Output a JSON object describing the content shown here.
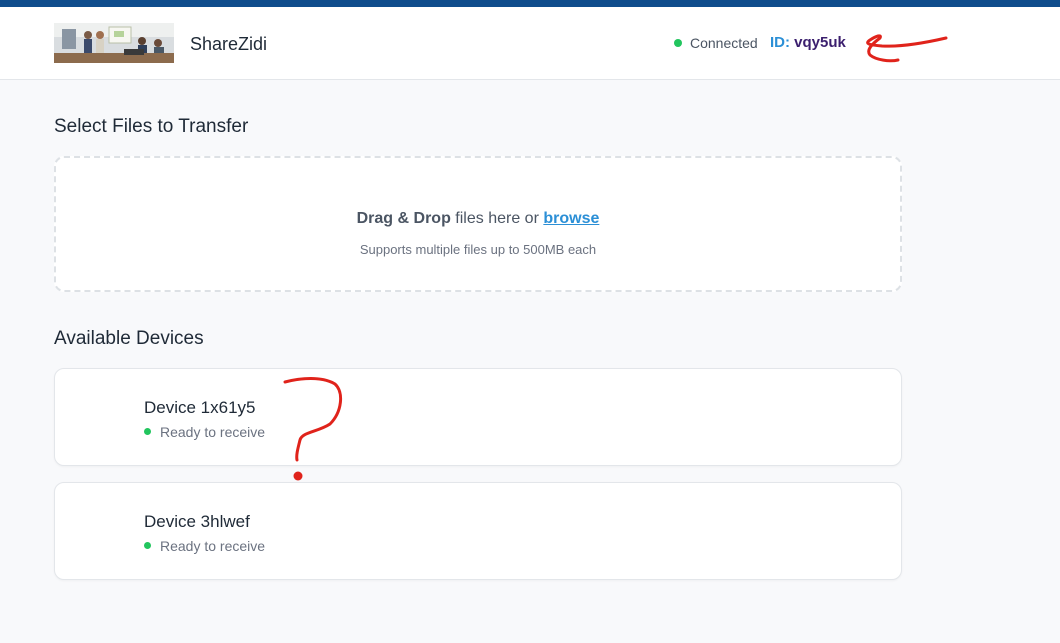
{
  "header": {
    "app_name": "ShareZidi",
    "status": "Connected",
    "id_label": "ID:",
    "id_value": "vqy5uk"
  },
  "upload": {
    "title": "Select Files to Transfer",
    "drag_drop": "Drag & Drop",
    "files_here_or": " files here or ",
    "browse": "browse",
    "hint": "Supports multiple files up to 500MB each"
  },
  "devices": {
    "title": "Available Devices",
    "items": [
      {
        "name": "Device 1x61y5",
        "status": "Ready to receive"
      },
      {
        "name": "Device 3hlwef",
        "status": "Ready to receive"
      }
    ]
  },
  "colors": {
    "topbar": "#0f4d8c",
    "status_green": "#22c55e",
    "link_blue": "#2b8fd6",
    "id_purple": "#3b1f6e",
    "annotation_red": "#e0231b"
  }
}
